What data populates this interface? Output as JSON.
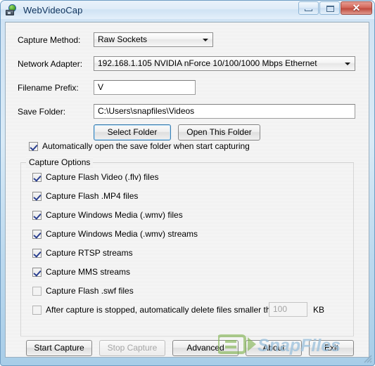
{
  "window": {
    "title": "WebVideoCap",
    "icon": "globe-camera-icon",
    "buttons": {
      "minimize": "minimize-button",
      "maximize": "maximize-button",
      "close": "✕"
    }
  },
  "form": {
    "capture_method": {
      "label": "Capture Method:",
      "value": "Raw Sockets"
    },
    "network_adapter": {
      "label": "Network Adapter:",
      "value": "192.168.1.105   NVIDIA nForce 10/100/1000 Mbps Ethernet"
    },
    "filename_prefix": {
      "label": "Filename Prefix:",
      "value": "V"
    },
    "save_folder": {
      "label": "Save Folder:",
      "value": "C:\\Users\\snapfiles\\Videos"
    },
    "select_folder_button": "Select Folder",
    "open_this_folder_button": "Open This Folder",
    "auto_open": {
      "label": "Automatically open the save folder when start capturing",
      "checked": true
    }
  },
  "capture_options": {
    "title": "Capture Options",
    "items": [
      {
        "label": "Capture Flash Video (.flv) files",
        "checked": true
      },
      {
        "label": "Capture Flash .MP4 files",
        "checked": true
      },
      {
        "label": "Capture Windows Media (.wmv) files",
        "checked": true
      },
      {
        "label": "Capture Windows Media (.wmv) streams",
        "checked": true
      },
      {
        "label": "Capture RTSP streams",
        "checked": true
      },
      {
        "label": "Capture MMS streams",
        "checked": true
      },
      {
        "label": "Capture Flash .swf files",
        "checked": false
      }
    ],
    "delete_small": {
      "label": "After capture is stopped, automatically delete files smaller than:",
      "checked": false,
      "value": "100",
      "unit": "KB"
    }
  },
  "footer": {
    "buttons": [
      {
        "label": "Start Capture",
        "disabled": false
      },
      {
        "label": "Stop Capture",
        "disabled": true
      },
      {
        "label": "Advanced",
        "disabled": false
      },
      {
        "label": "About",
        "disabled": false
      },
      {
        "label": "Exit",
        "disabled": false
      }
    ]
  },
  "watermark": {
    "text": "SnapFiles",
    "logo": "S",
    "text_color": "#9dc2dd",
    "logo_color": "#8dbf5e"
  }
}
